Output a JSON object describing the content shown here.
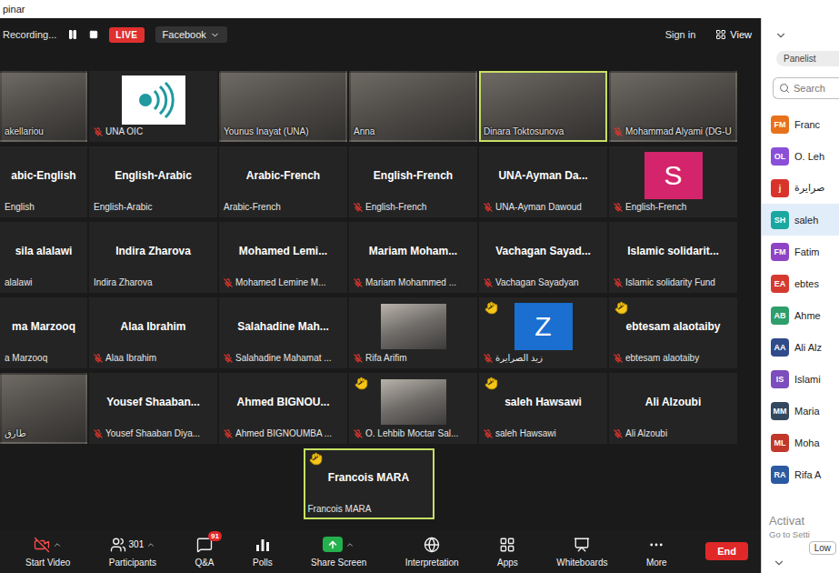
{
  "window": {
    "title": "pinar"
  },
  "meeting_bar": {
    "recording": "Recording...",
    "live": "LIVE",
    "stream": "Facebook",
    "sign_in": "Sign in",
    "view": "View"
  },
  "tile_rows": [
    [
      {
        "kind": "video",
        "label": "akellariou",
        "muted": false,
        "hand_raised": false,
        "active": false
      },
      {
        "kind": "logo",
        "label": "UNA OIC",
        "muted": true,
        "hand_raised": false,
        "active": false
      },
      {
        "kind": "video",
        "label": "Younus Inayat (UNA)",
        "muted": false,
        "hand_raised": false,
        "active": false
      },
      {
        "kind": "video",
        "label": "Anna",
        "muted": false,
        "hand_raised": false,
        "active": false
      },
      {
        "kind": "video",
        "label": "Dinara Toktosunova",
        "muted": false,
        "hand_raised": false,
        "active": true
      },
      {
        "kind": "video",
        "label": "Mohammad Alyami (DG-U",
        "muted": true,
        "hand_raised": false,
        "active": false
      }
    ],
    [
      {
        "kind": "name",
        "name": "abic-English",
        "label": "English",
        "muted": false,
        "hand_raised": false,
        "active": false
      },
      {
        "kind": "name",
        "name": "English-Arabic",
        "label": "English-Arabic",
        "muted": false,
        "hand_raised": false,
        "active": false
      },
      {
        "kind": "name",
        "name": "Arabic-French",
        "label": "Arabic-French",
        "muted": false,
        "hand_raised": false,
        "active": false
      },
      {
        "kind": "name",
        "name": "English-French",
        "label": "English-French",
        "muted": true,
        "hand_raised": false,
        "active": false
      },
      {
        "kind": "name",
        "name": "UNA-Ayman Da...",
        "label": "UNA-Ayman Dawoud",
        "muted": true,
        "hand_raised": false,
        "active": false
      },
      {
        "kind": "avatar",
        "letter": "S",
        "color": "#d4246c",
        "label": "English-French",
        "muted": true,
        "hand_raised": false,
        "active": false
      }
    ],
    [
      {
        "kind": "name",
        "name": "sila alalawi",
        "label": "alalawi",
        "muted": false,
        "hand_raised": false,
        "active": false
      },
      {
        "kind": "name",
        "name": "Indira Zharova",
        "label": "Indira Zharova",
        "muted": false,
        "hand_raised": false,
        "active": false
      },
      {
        "kind": "name",
        "name": "Mohamed Lemi...",
        "label": "Mohamed Lemine M...",
        "muted": true,
        "hand_raised": false,
        "active": false
      },
      {
        "kind": "name",
        "name": "Mariam Moham...",
        "label": "Mariam Mohammed ...",
        "muted": true,
        "hand_raised": false,
        "active": false
      },
      {
        "kind": "name",
        "name": "Vachagan Sayad...",
        "label": "Vachagan Sayadyan",
        "muted": true,
        "hand_raised": false,
        "active": false
      },
      {
        "kind": "name",
        "name": "Islamic solidarit...",
        "label": "Islamic solidarity Fund",
        "muted": true,
        "hand_raised": false,
        "active": false
      }
    ],
    [
      {
        "kind": "name",
        "name": "ma Marzooq",
        "label": "a Marzooq",
        "muted": false,
        "hand_raised": false,
        "active": false
      },
      {
        "kind": "name",
        "name": "Alaa Ibrahim",
        "label": "Alaa Ibrahim",
        "muted": true,
        "hand_raised": false,
        "active": false
      },
      {
        "kind": "name",
        "name": "Salahadine Mah...",
        "label": "Salahadine Mahamat ...",
        "muted": true,
        "hand_raised": false,
        "active": false
      },
      {
        "kind": "video-inset",
        "label": "Rifa Arifim",
        "muted": true,
        "hand_raised": false,
        "active": false
      },
      {
        "kind": "avatar",
        "letter": "Z",
        "color": "#1a6fd0",
        "label": "زيد الصرايرة",
        "muted": true,
        "hand_raised": true,
        "active": false
      },
      {
        "kind": "name",
        "name": "ebtesam alaotaiby",
        "label": "ebtesam alaotaiby",
        "muted": true,
        "hand_raised": true,
        "active": false
      }
    ],
    [
      {
        "kind": "video",
        "label": "طارق",
        "muted": false,
        "hand_raised": false,
        "active": false
      },
      {
        "kind": "name",
        "name": "Yousef Shaaban...",
        "label": "Yousef Shaaban Diya...",
        "muted": true,
        "hand_raised": false,
        "active": false
      },
      {
        "kind": "name",
        "name": "Ahmed BIGNOU...",
        "label": "Ahmed BIGNOUMBA ...",
        "muted": true,
        "hand_raised": false,
        "active": false
      },
      {
        "kind": "video-inset",
        "label": "O. Lehbib Moctar Sal...",
        "muted": true,
        "hand_raised": true,
        "active": false
      },
      {
        "kind": "name",
        "name": "saleh Hawsawi",
        "label": "saleh Hawsawi",
        "muted": true,
        "hand_raised": true,
        "active": false
      },
      {
        "kind": "name",
        "name": "Ali Alzoubi",
        "label": "Ali Alzoubi",
        "muted": true,
        "hand_raised": false,
        "active": false
      }
    ],
    [
      {
        "kind": "name",
        "name": "Francois MARA",
        "label": "Francois MARA",
        "muted": false,
        "hand_raised": true,
        "active": true
      }
    ]
  ],
  "toolbar": [
    {
      "label": "Start Video",
      "caret": true,
      "off": true,
      "highlight": false
    },
    {
      "label": "Participants",
      "count": "301",
      "caret": true,
      "off": false,
      "highlight": false
    },
    {
      "label": "Q&A",
      "badge": "91",
      "caret": false,
      "off": false,
      "highlight": false
    },
    {
      "label": "Polls",
      "caret": false,
      "off": false,
      "highlight": false
    },
    {
      "label": "Share Screen",
      "caret": true,
      "off": false,
      "highlight": true
    },
    {
      "label": "Interpretation",
      "caret": false,
      "off": false,
      "highlight": false
    },
    {
      "label": "Apps",
      "caret": false,
      "off": false,
      "highlight": false
    },
    {
      "label": "Whiteboards",
      "caret": false,
      "off": false,
      "highlight": false
    },
    {
      "label": "More",
      "caret": false,
      "off": false,
      "highlight": false
    }
  ],
  "end_button": "End",
  "panel": {
    "tab": "Panelist",
    "search_placeholder": "Search",
    "participants": [
      {
        "initials": "FM",
        "name": "Franc",
        "color": "#e8711c",
        "selected": false
      },
      {
        "initials": "OL",
        "name": "O. Leh",
        "color": "#8a4fd8",
        "selected": false
      },
      {
        "initials": "j",
        "name": "صرايرة",
        "color": "#d9342b",
        "selected": false
      },
      {
        "initials": "SH",
        "name": "saleh",
        "color": "#1aa7a0",
        "selected": true
      },
      {
        "initials": "FM",
        "name": "Fatim",
        "color": "#8e44c4",
        "selected": false
      },
      {
        "initials": "EA",
        "name": "ebtes",
        "color": "#d63a2f",
        "selected": false
      },
      {
        "initials": "AB",
        "name": "Ahme",
        "color": "#2e9e6a",
        "selected": false
      },
      {
        "initials": "AA",
        "name": "Ali Alz",
        "color": "#2f4b8a",
        "selected": false
      },
      {
        "initials": "IS",
        "name": "Islami",
        "color": "#7c4dbd",
        "selected": false
      },
      {
        "initials": "MM",
        "name": "Maria",
        "color": "#34495e",
        "selected": false
      },
      {
        "initials": "ML",
        "name": "Moha",
        "color": "#c0392b",
        "selected": false
      },
      {
        "initials": "RA",
        "name": "Rifa A",
        "color": "#2c5aa0",
        "selected": false
      }
    ],
    "watermark": [
      "Activat",
      "Go to Setti"
    ],
    "low_button": "Low"
  }
}
